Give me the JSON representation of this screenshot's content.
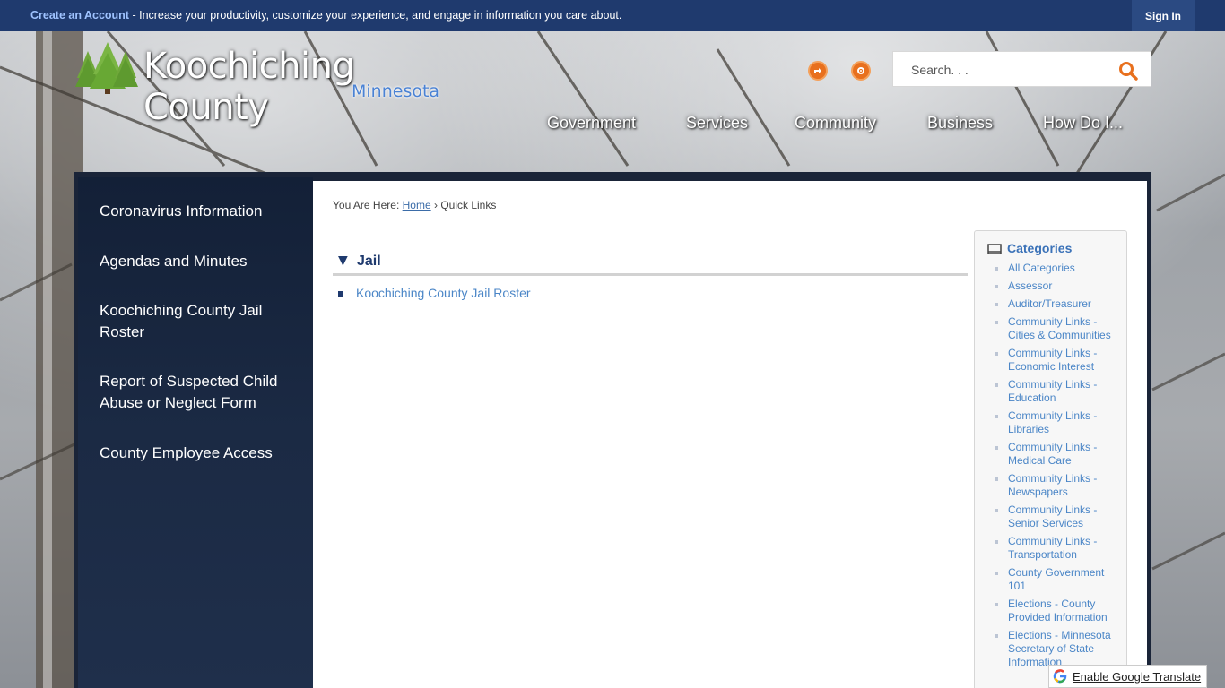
{
  "topbar": {
    "create_account": "Create an Account",
    "message": " - Increase your productivity, customize your experience, and engage in information you care about.",
    "sign_in": "Sign In"
  },
  "logo": {
    "name": "Koochiching County",
    "state": "Minnesota"
  },
  "search": {
    "placeholder": "Search. . ."
  },
  "icons": {
    "share": "share-icon",
    "settings": "gear-icon",
    "search": "search-icon"
  },
  "nav": [
    "Government",
    "Services",
    "Community",
    "Business",
    "How Do I..."
  ],
  "sidebar": {
    "items": [
      "Coronavirus Information",
      "Agendas and Minutes",
      "Koochiching County Jail Roster",
      "Report of Suspected Child Abuse or Neglect Form",
      "County Employee Access"
    ]
  },
  "breadcrumb": {
    "prefix": "You Are Here:",
    "home": "Home",
    "separator": "›",
    "current": "Quick Links"
  },
  "section": {
    "title": "Jail",
    "links": [
      "Koochiching County Jail Roster"
    ]
  },
  "categories": {
    "heading": "Categories",
    "items": [
      "All Categories",
      "Assessor",
      "Auditor/Treasurer",
      "Community Links - Cities & Communities",
      "Community Links - Economic Interest",
      "Community Links - Education",
      "Community Links - Libraries",
      "Community Links - Medical Care",
      "Community Links - Newspapers",
      "Community Links - Senior Services",
      "Community Links - Transportation",
      "County Government 101",
      "Elections - County Provided Information",
      "Elections - Minnesota Secretary of State Information"
    ]
  },
  "translate": {
    "label": "Enable Google Translate"
  },
  "colors": {
    "topbar": "#1f3a6e",
    "link": "#4b86c7",
    "accent_orange": "#e8701e"
  }
}
